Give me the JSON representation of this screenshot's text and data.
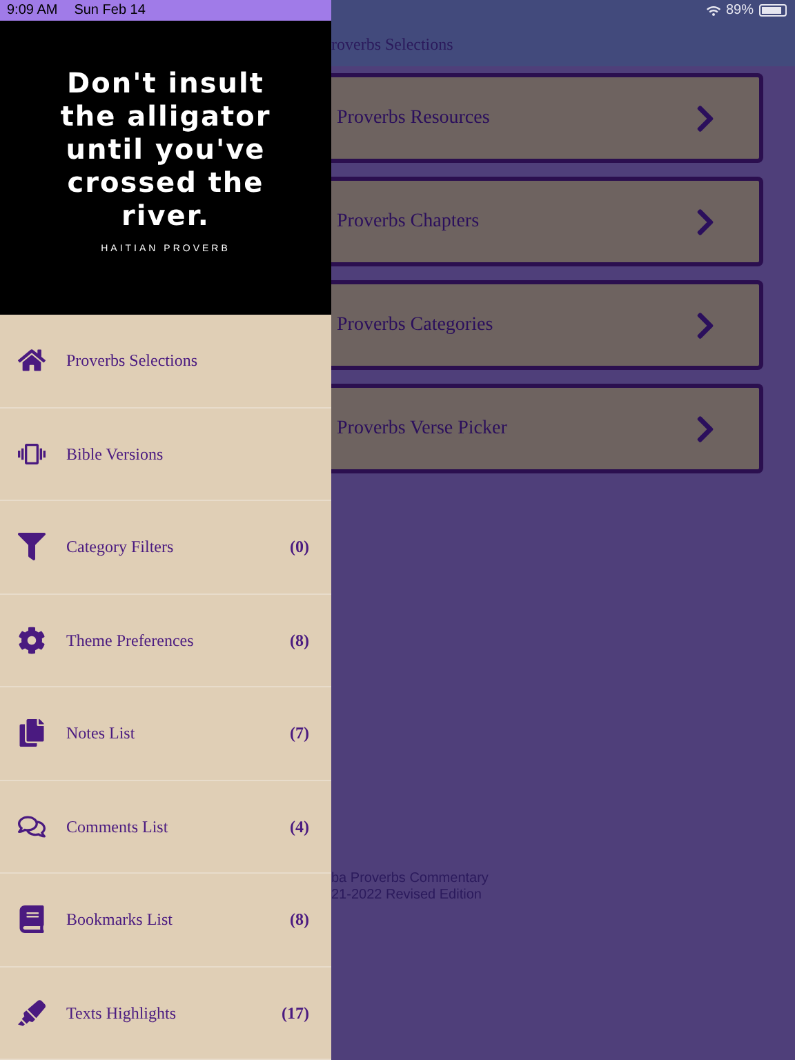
{
  "status_bar": {
    "time": "9:09 AM",
    "date": "Sun Feb 14",
    "battery": "89%"
  },
  "drawer": {
    "quote": "Don't insult the alligator until you've crossed the river.",
    "attribution": "HAITIAN PROVERB",
    "items": [
      {
        "kind": "home",
        "label": "Proverbs Selections"
      },
      {
        "kind": "device",
        "label": "Bible Versions"
      },
      {
        "kind": "filter",
        "label": "Category Filters",
        "count": "(0)"
      },
      {
        "kind": "gear",
        "label": "Theme Preferences",
        "count": "(8)"
      },
      {
        "kind": "copy",
        "label": "Notes List",
        "count": "(7)"
      },
      {
        "kind": "comments",
        "label": "Comments List",
        "count": "(4)"
      },
      {
        "kind": "book",
        "label": "Bookmarks List",
        "count": "(8)"
      },
      {
        "kind": "marker",
        "label": "Texts Highlights",
        "count": "(17)"
      }
    ]
  },
  "main": {
    "header_title": "roverbs Selections",
    "cards": [
      {
        "label": "Proverbs Resources"
      },
      {
        "label": "Proverbs Chapters"
      },
      {
        "label": "Proverbs Categories"
      },
      {
        "label": "Proverbs Verse Picker"
      }
    ],
    "footer_lines": [
      "ba Proverbs Commentary",
      "21-2022 Revised Edition"
    ]
  }
}
